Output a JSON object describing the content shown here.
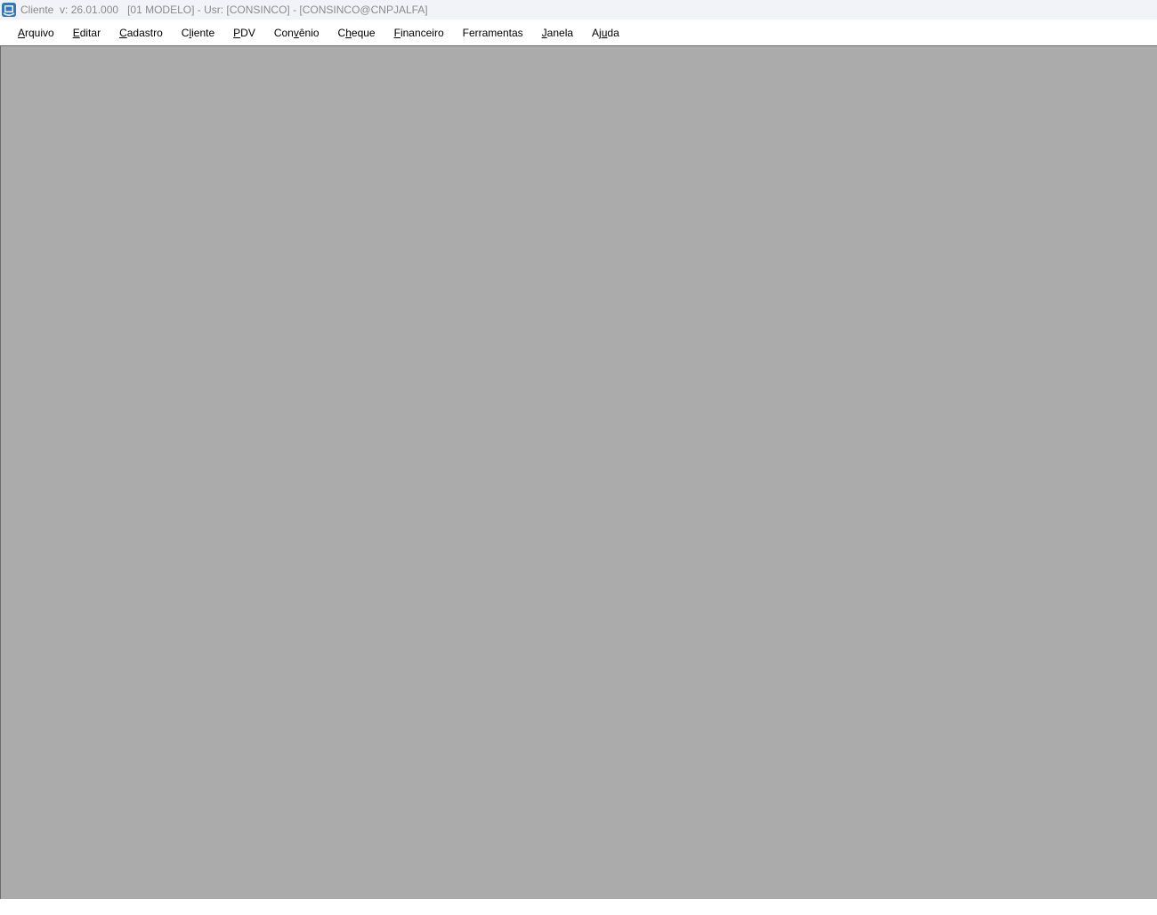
{
  "window": {
    "title": "Cliente  v: 26.01.000   [01 MODELO] - Usr: [CONSINCO] - [CONSINCO@CNPJALFA]",
    "icon": "app-logo-icon"
  },
  "menubar": {
    "items": [
      {
        "accel": "A",
        "rest": "rquivo",
        "pre": ""
      },
      {
        "accel": "E",
        "rest": "ditar",
        "pre": ""
      },
      {
        "accel": "C",
        "rest": "adastro",
        "pre": ""
      },
      {
        "pre": "C",
        "accel": "l",
        "rest": "iente"
      },
      {
        "accel": "P",
        "rest": "DV",
        "pre": ""
      },
      {
        "pre": "Con",
        "accel": "v",
        "rest": "ênio"
      },
      {
        "pre": "C",
        "accel": "h",
        "rest": "eque"
      },
      {
        "accel": "F",
        "rest": "inanceiro",
        "pre": ""
      },
      {
        "pre": "Ferramentas",
        "accel": "",
        "rest": ""
      },
      {
        "accel": "J",
        "rest": "anela",
        "pre": ""
      },
      {
        "pre": "Aj",
        "accel": "u",
        "rest": "da"
      }
    ]
  },
  "colors": {
    "mdi_background": "#ababab",
    "titlebar_background": "#f2f3f9",
    "title_text": "#8a8a8a",
    "icon_blue": "#2f78c5"
  }
}
